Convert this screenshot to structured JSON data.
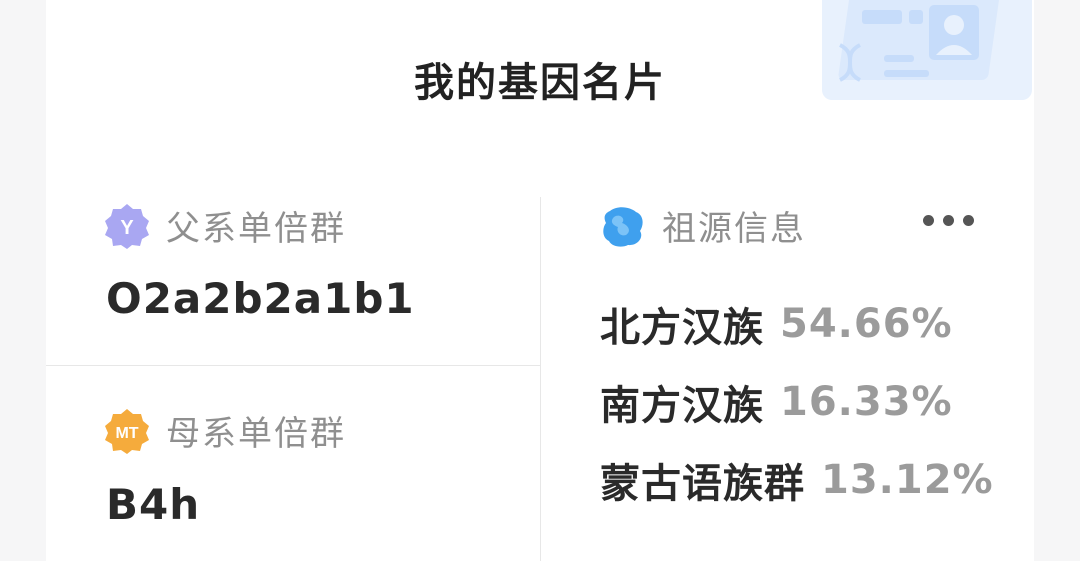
{
  "title": "我的基因名片",
  "paternal": {
    "badge_text": "Y",
    "label": "父系单倍群",
    "value": "O2a2b2a1b1",
    "badge_color": "#a9a7f2"
  },
  "maternal": {
    "badge_text": "MT",
    "label": "母系单倍群",
    "value": "B4h",
    "badge_color": "#f5ab3c"
  },
  "ancestry": {
    "label": "祖源信息",
    "icon": "globe-blob-icon",
    "icon_color": "#3fa0ee",
    "more_icon": "more-dots-icon",
    "items": [
      {
        "name": "北方汉族",
        "percent": "54.66%"
      },
      {
        "name": "南方汉族",
        "percent": "16.33%"
      },
      {
        "name": "蒙古语族群",
        "percent": "13.12%"
      }
    ]
  },
  "decoration_icon": "id-card-dna-icon"
}
